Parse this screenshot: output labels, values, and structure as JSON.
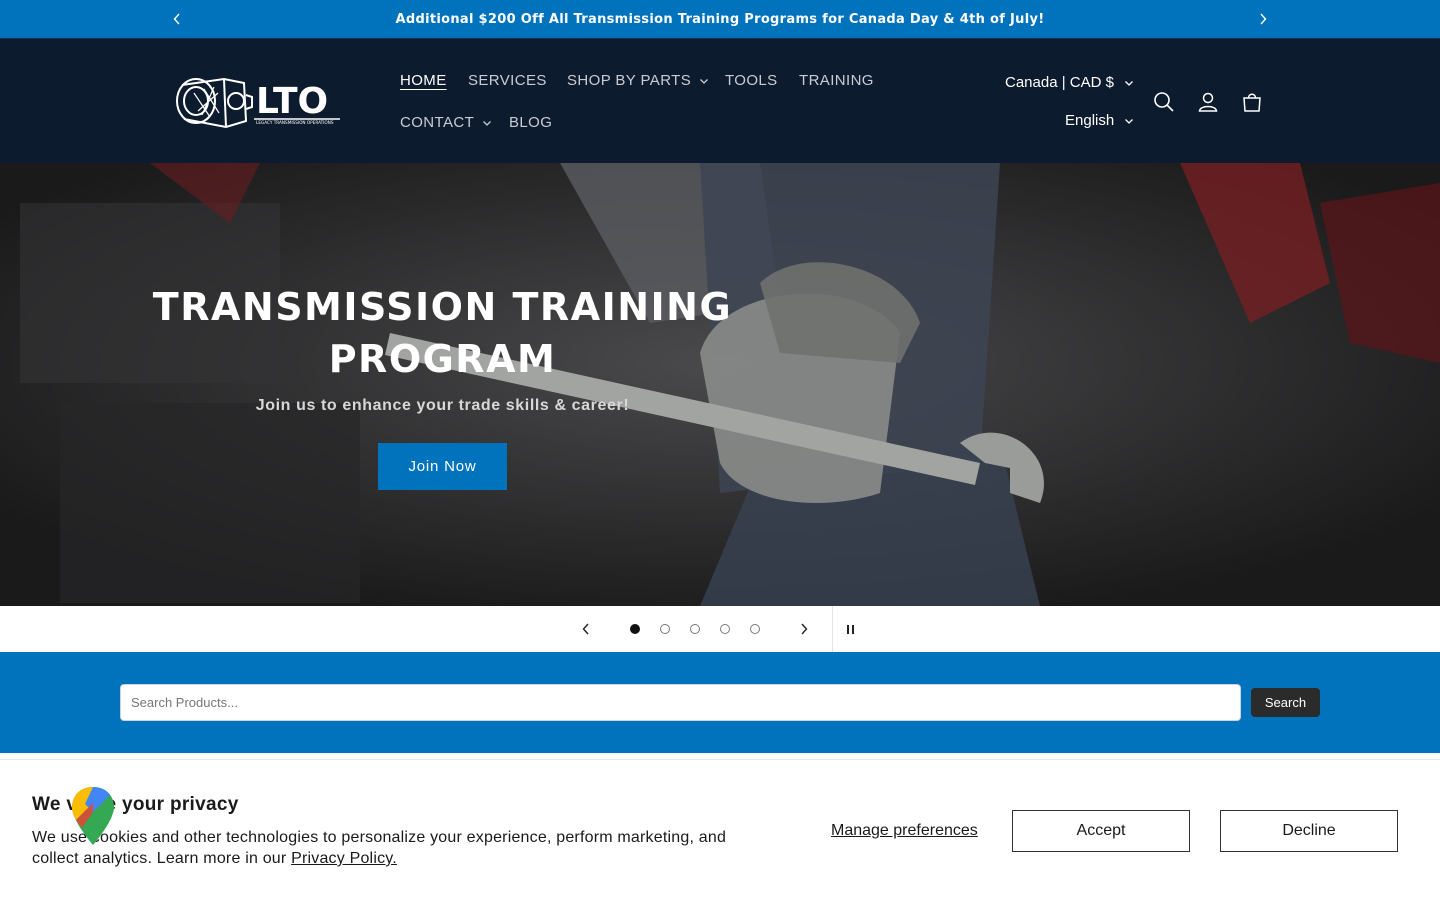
{
  "announcement": {
    "text": "Additional $200 Off All Transmission Training Programs for Canada Day & 4th of July!",
    "prev_icon": "chevron-left-icon",
    "next_icon": "chevron-right-icon"
  },
  "header": {
    "logo_text": "LTO",
    "logo_subtext": "LEGACY TRANSMISSION OPERATIONS",
    "nav": [
      {
        "label": "HOME",
        "active": true,
        "dropdown": false
      },
      {
        "label": "SERVICES",
        "active": false,
        "dropdown": false
      },
      {
        "label": "SHOP BY PARTS",
        "active": false,
        "dropdown": true
      },
      {
        "label": "TOOLS",
        "active": false,
        "dropdown": false
      },
      {
        "label": "TRAINING",
        "active": false,
        "dropdown": false
      },
      {
        "label": "CONTACT",
        "active": false,
        "dropdown": true
      },
      {
        "label": "BLOG",
        "active": false,
        "dropdown": false
      }
    ],
    "currency": "Canada | CAD $",
    "language": "English",
    "icons": [
      "search-icon",
      "account-icon",
      "cart-icon"
    ]
  },
  "hero": {
    "title_line1": "TRANSMISSION TRAINING",
    "title_line2": "PROGRAM",
    "subtitle": "Join us to enhance your trade skills & career!",
    "button": "Join Now"
  },
  "slider": {
    "slide_count": 5,
    "current_slide": 1
  },
  "search": {
    "placeholder": "Search Products...",
    "value": "",
    "button": "Search"
  },
  "cookie": {
    "title": "We value your privacy",
    "text": "We use cookies and other technologies to personalize your experience, perform marketing, and collect analytics. Learn more in our",
    "policy_link": "Privacy Policy.",
    "manage": "Manage preferences",
    "accept": "Accept",
    "decline": "Decline"
  },
  "colors": {
    "accent_blue": "#0073bc",
    "header_navy": "#0d1b2e",
    "button_dark": "#2b2b2b"
  }
}
